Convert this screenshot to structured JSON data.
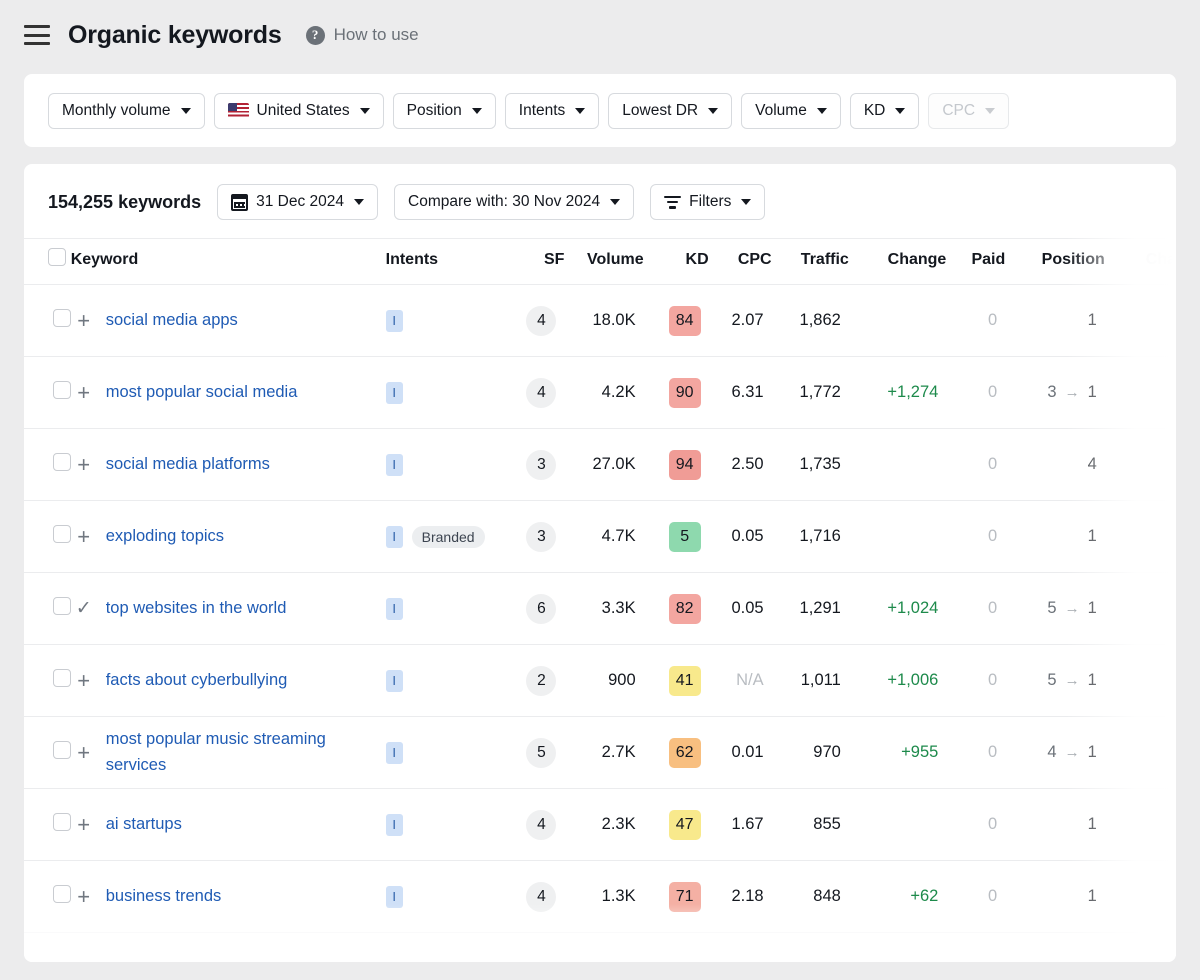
{
  "header": {
    "menu_icon": "hamburger-icon",
    "title": "Organic keywords",
    "help_icon": "question-mark-icon",
    "help_label": "How to use"
  },
  "filter_bar": {
    "chips": [
      {
        "label": "Monthly volume",
        "icon": null,
        "faded": false
      },
      {
        "label": "United States",
        "icon": "us-flag-icon",
        "faded": false
      },
      {
        "label": "Position",
        "icon": null,
        "faded": false
      },
      {
        "label": "Intents",
        "icon": null,
        "faded": false
      },
      {
        "label": "Lowest DR",
        "icon": null,
        "faded": false
      },
      {
        "label": "Volume",
        "icon": null,
        "faded": false
      },
      {
        "label": "KD",
        "icon": null,
        "faded": false
      },
      {
        "label": "CPC",
        "icon": null,
        "faded": true
      }
    ]
  },
  "toolbar": {
    "keyword_count": "154,255 keywords",
    "date_label": "31 Dec 2024",
    "compare_label": "Compare with: 30 Nov 2024",
    "filters_label": "Filters"
  },
  "table": {
    "columns": [
      {
        "key": "keyword",
        "label": "Keyword",
        "faded": false
      },
      {
        "key": "intents",
        "label": "Intents",
        "faded": false
      },
      {
        "key": "sf",
        "label": "SF",
        "faded": false
      },
      {
        "key": "volume",
        "label": "Volume",
        "faded": false
      },
      {
        "key": "kd",
        "label": "KD",
        "faded": false
      },
      {
        "key": "cpc",
        "label": "CPC",
        "faded": false
      },
      {
        "key": "traffic",
        "label": "Traffic",
        "faded": false
      },
      {
        "key": "change",
        "label": "Change",
        "faded": false
      },
      {
        "key": "paid",
        "label": "Paid",
        "faded": false
      },
      {
        "key": "position",
        "label": "Position",
        "faded": false
      },
      {
        "key": "change2",
        "label": "Cha",
        "faded": true
      }
    ],
    "rows": [
      {
        "keyword": "social media apps",
        "action_icon": "plus-icon",
        "intents": [
          "I"
        ],
        "branded": null,
        "sf": "4",
        "volume": "18.0K",
        "kd": "84",
        "kd_color": "#f3a6a0",
        "cpc": "2.07",
        "cpc_muted": false,
        "traffic": "1,862",
        "change": "",
        "paid": "0",
        "position_old": "",
        "position_new": "1"
      },
      {
        "keyword": "most popular social media",
        "action_icon": "plus-icon",
        "intents": [
          "I"
        ],
        "branded": null,
        "sf": "4",
        "volume": "4.2K",
        "kd": "90",
        "kd_color": "#f3a6a0",
        "cpc": "6.31",
        "cpc_muted": false,
        "traffic": "1,772",
        "change": "+1,274",
        "paid": "0",
        "position_old": "3",
        "position_new": "1"
      },
      {
        "keyword": "social media platforms",
        "action_icon": "plus-icon",
        "intents": [
          "I"
        ],
        "branded": null,
        "sf": "3",
        "volume": "27.0K",
        "kd": "94",
        "kd_color": "#f09c96",
        "cpc": "2.50",
        "cpc_muted": false,
        "traffic": "1,735",
        "change": "",
        "paid": "0",
        "position_old": "",
        "position_new": "4"
      },
      {
        "keyword": "exploding topics",
        "action_icon": "plus-icon",
        "intents": [
          "I"
        ],
        "branded": "Branded",
        "sf": "3",
        "volume": "4.7K",
        "kd": "5",
        "kd_color": "#8ed9ae",
        "cpc": "0.05",
        "cpc_muted": false,
        "traffic": "1,716",
        "change": "",
        "paid": "0",
        "position_old": "",
        "position_new": "1"
      },
      {
        "keyword": "top websites in the world",
        "action_icon": "check-icon",
        "intents": [
          "I"
        ],
        "branded": null,
        "sf": "6",
        "volume": "3.3K",
        "kd": "82",
        "kd_color": "#f3a6a0",
        "cpc": "0.05",
        "cpc_muted": false,
        "traffic": "1,291",
        "change": "+1,024",
        "paid": "0",
        "position_old": "5",
        "position_new": "1"
      },
      {
        "keyword": "facts about cyberbullying",
        "action_icon": "plus-icon",
        "intents": [
          "I"
        ],
        "branded": null,
        "sf": "2",
        "volume": "900",
        "kd": "41",
        "kd_color": "#f8e98c",
        "cpc": "N/A",
        "cpc_muted": true,
        "traffic": "1,011",
        "change": "+1,006",
        "paid": "0",
        "position_old": "5",
        "position_new": "1"
      },
      {
        "keyword": "most popular music streaming services",
        "action_icon": "plus-icon",
        "intents": [
          "I"
        ],
        "branded": null,
        "sf": "5",
        "volume": "2.7K",
        "kd": "62",
        "kd_color": "#f8bf80",
        "cpc": "0.01",
        "cpc_muted": false,
        "traffic": "970",
        "change": "+955",
        "paid": "0",
        "position_old": "4",
        "position_new": "1"
      },
      {
        "keyword": "ai startups",
        "action_icon": "plus-icon",
        "intents": [
          "I"
        ],
        "branded": null,
        "sf": "4",
        "volume": "2.3K",
        "kd": "47",
        "kd_color": "#f8e98c",
        "cpc": "1.67",
        "cpc_muted": false,
        "traffic": "855",
        "change": "",
        "paid": "0",
        "position_old": "",
        "position_new": "1"
      },
      {
        "keyword": "business trends",
        "action_icon": "plus-icon",
        "intents": [
          "I"
        ],
        "branded": null,
        "sf": "4",
        "volume": "1.3K",
        "kd": "71",
        "kd_color": "#f4b0a4",
        "cpc": "2.18",
        "cpc_muted": false,
        "traffic": "848",
        "change": "+62",
        "paid": "0",
        "position_old": "",
        "position_new": "1"
      }
    ]
  },
  "colors": {
    "link": "#1f5bb4",
    "positive": "#1d8a4b",
    "intent_badge_bg": "#cfe0f7",
    "page_bg": "#ececed"
  }
}
